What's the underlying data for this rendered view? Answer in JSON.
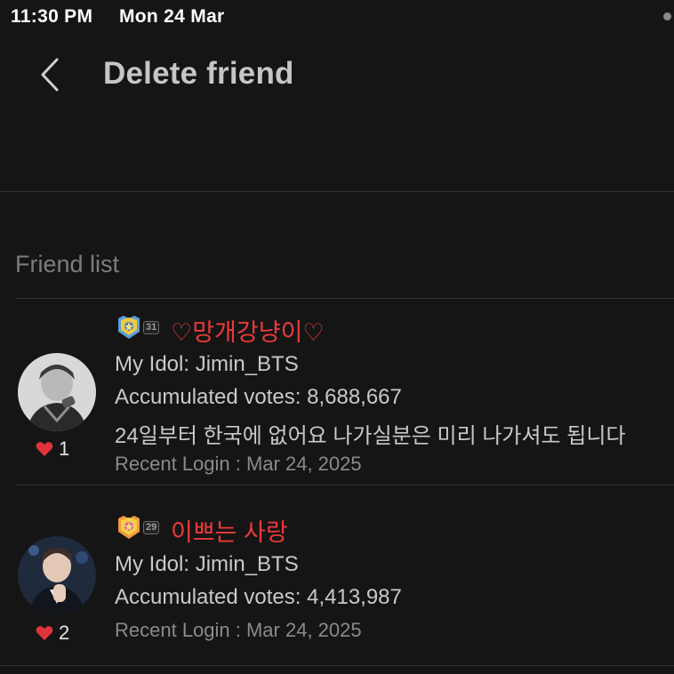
{
  "status_bar": {
    "time": "11:30 PM",
    "date": "Mon 24 Mar"
  },
  "header": {
    "title": "Delete friend"
  },
  "section": {
    "label": "Friend list"
  },
  "friends": [
    {
      "badge_icon": "level-medal-icon",
      "level": "31",
      "nickname": "♡망개강냥이♡",
      "idol": "My Idol: Jimin_BTS",
      "votes": "Accumulated votes: 8,688,667",
      "message": "24일부터 한국에 없어요 나가실분은 미리 나가셔도 됩니다",
      "recent_login": "Recent Login : Mar 24, 2025",
      "likes": "1"
    },
    {
      "badge_icon": "level-medal-icon",
      "level": "29",
      "nickname": "이쁘는 사랑",
      "idol": "My Idol: Jimin_BTS",
      "votes": "Accumulated votes: 4,413,987",
      "recent_login": "Recent Login : Mar 24, 2025",
      "likes": "2"
    }
  ],
  "colors": {
    "background": "#151515",
    "nickname": "#ea3a3a",
    "heart": "#e0343b"
  }
}
